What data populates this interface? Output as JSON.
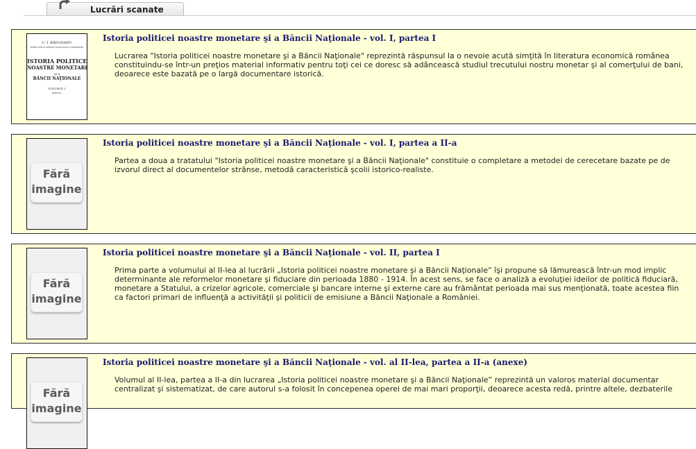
{
  "tab": {
    "label": "Lucrări scanate"
  },
  "items": [
    {
      "title": "Istoria politicei noastre monetare şi a Băncii Naţionale - vol. I, partea I",
      "thumb": {
        "type": "cover",
        "author": "C. I. BĂICOIANU",
        "subtitle": "DIRECTOR AL BĂNCII NAŢIONALE A ROMÂNIEI",
        "title_lines": [
          "ISTORIA POLITICEI",
          "NOASTRE MONETARE",
          "ŞI A",
          "BĂNCII NAŢIONALE"
        ],
        "volume": "VOLUMUL I",
        "part": "PARTEA I"
      },
      "desc": [
        "Lucrarea \"Istoria politicei noastre monetare şi a Băncii Naţionale\" reprezintă răspunsul la o nevoie acută simţită în literatura economică românea",
        "constituindu-se într-un preţios material informativ pentru toţi cei ce doresc să adâncească studiul trecutului nostru monetar şi al comerţului de bani,",
        "deoarece este bazată pe o largă documentare istorică."
      ]
    },
    {
      "title": "Istoria politicei noastre monetare şi a Băncii Naţionale - vol. I, partea a II-a",
      "thumb": {
        "type": "noimage",
        "line1": "Fără",
        "line2": "imagine"
      },
      "desc": [
        "Partea a doua a tratatului \"Istoria politicei noastre monetare şi a Băncii Naţionale\" constituie o completare a metodei de cerecetare bazate pe de",
        "izvorul direct al documentelor strânse, metodă caracteristică şcolii istorico-realiste."
      ]
    },
    {
      "title": "Istoria politicei noastre monetare şi a Băncii Naţionale - vol. II, partea I",
      "thumb": {
        "type": "noimage",
        "line1": "Fără",
        "line2": "imagine"
      },
      "desc": [
        "Prima parte a volumului al II-lea al lucrării „Istoria politicei noastre monetare şi a Băncii Naţionale” îşi propune să lămurească într-un mod implic",
        "determinante ale reformelor monetare şi fiduciare din perioada 1880 - 1914. În acest sens, se face o analiză a evoluţiei ideilor de politică fiduciară,",
        "monetare a Statului, a crizelor agricole, comerciale şi bancare interne şi externe care au frământat perioada mai sus menţionată, toate acestea fiin",
        "ca factori primari de influenţă a activităţii şi politicii de emisiune a Băncii Naţionale a României."
      ]
    },
    {
      "title": "Istoria politicei noastre monetare şi a Băncii Naţionale - vol. al II-lea, partea a II-a (anexe)",
      "thumb": {
        "type": "noimage",
        "line1": "Fără",
        "line2": "imagine"
      },
      "desc": [
        "Volumul al II-lea, partea a II-a din lucrarea  „Istoria politicei noastre monetare şi a Băncii Naţionale” reprezintă un valoros material documentar",
        "centralizat şi sistematizat, de care autorul s-a folosit în concepenea operei de mai mari proporţii, deoarece acesta redă, printre altele, dezbaterile"
      ]
    }
  ]
}
